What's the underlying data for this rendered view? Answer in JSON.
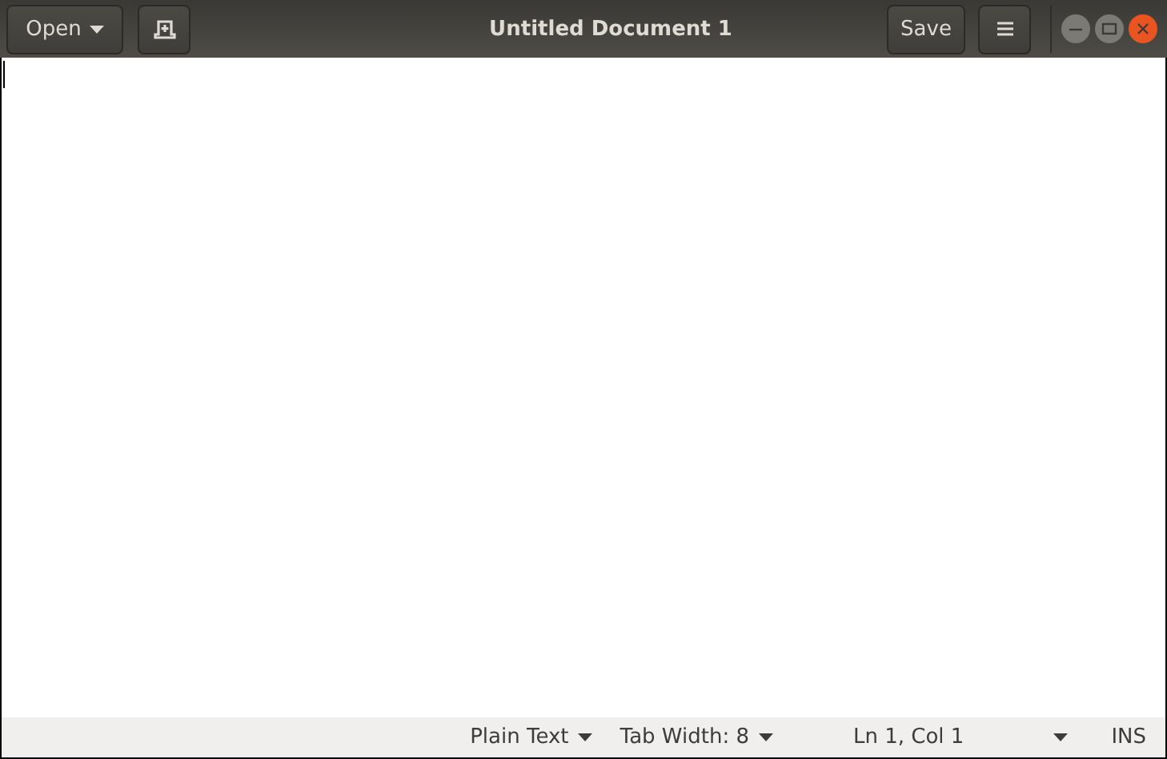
{
  "window": {
    "title": "Untitled Document 1"
  },
  "header": {
    "open_button": "Open",
    "save_button": "Save"
  },
  "status_bar": {
    "language": "Plain Text",
    "tab_width": "Tab Width: 8",
    "position": "Ln 1, Col 1",
    "mode": "INS"
  }
}
